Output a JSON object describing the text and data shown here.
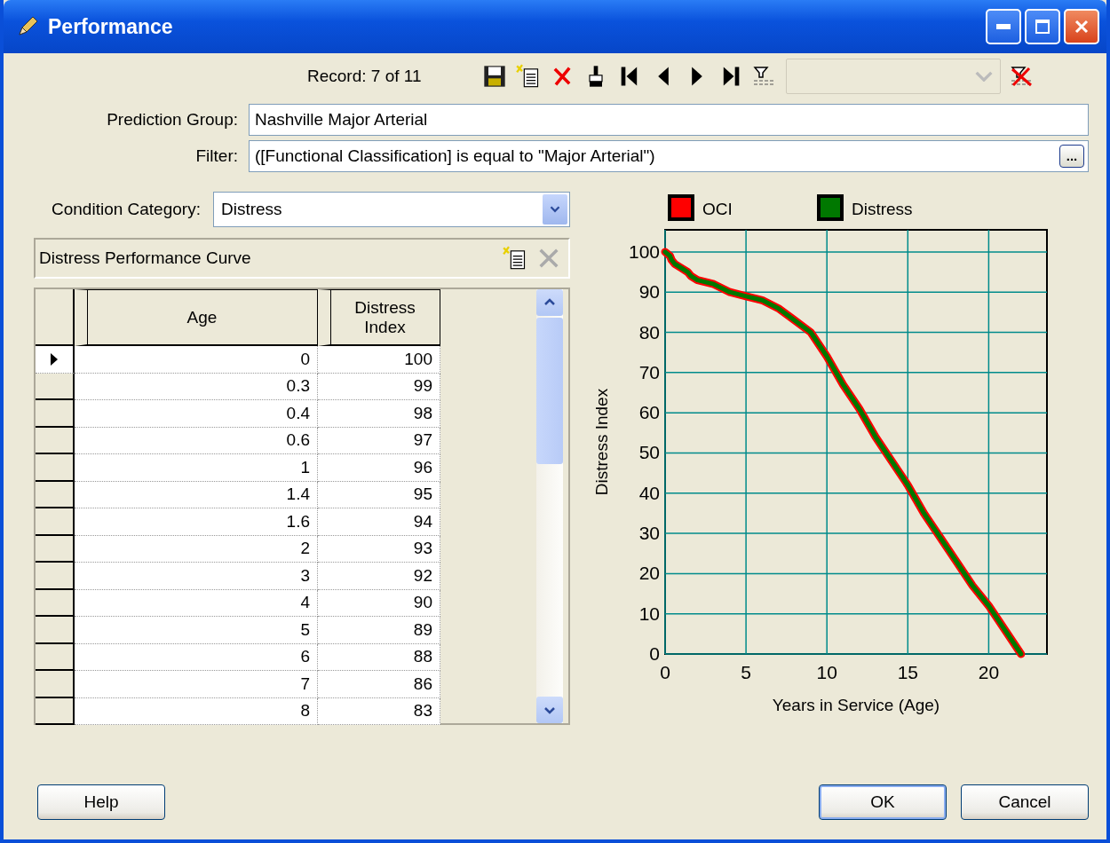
{
  "window": {
    "title": "Performance"
  },
  "toolbar": {
    "record": "Record: 7 of 11",
    "filter_combo": {
      "disabled": true
    }
  },
  "fields": [
    {
      "label": "Prediction Group:",
      "value": "Nashville Major Arterial",
      "kind": "text"
    },
    {
      "label": "Filter:",
      "value": "([Functional Classification] is equal to \"Major Arterial\")",
      "kind": "browse",
      "button": "..."
    }
  ],
  "condition_category": {
    "label": "Condition Category:",
    "value": "Distress"
  },
  "curve_panel": {
    "title": "Distress Performance Curve",
    "columns": [
      "Age",
      "Distress Index"
    ],
    "rows": [
      {
        "age": "0",
        "index": "100",
        "selected": true
      },
      {
        "age": "0.3",
        "index": "99",
        "selected": false
      },
      {
        "age": "0.4",
        "index": "98",
        "selected": false
      },
      {
        "age": "0.6",
        "index": "97",
        "selected": false
      },
      {
        "age": "1",
        "index": "96",
        "selected": false
      },
      {
        "age": "1.4",
        "index": "95",
        "selected": false
      },
      {
        "age": "1.6",
        "index": "94",
        "selected": false
      },
      {
        "age": "2",
        "index": "93",
        "selected": false
      },
      {
        "age": "3",
        "index": "92",
        "selected": false
      },
      {
        "age": "4",
        "index": "90",
        "selected": false
      },
      {
        "age": "5",
        "index": "89",
        "selected": false
      },
      {
        "age": "6",
        "index": "88",
        "selected": false
      },
      {
        "age": "7",
        "index": "86",
        "selected": false
      },
      {
        "age": "8",
        "index": "83",
        "selected": false
      }
    ]
  },
  "chart": {
    "chart_data": {
      "type": "line",
      "xlabel": "Years in Service (Age)",
      "ylabel": "Distress Index",
      "x": [
        0,
        0.3,
        0.4,
        0.6,
        1,
        1.4,
        1.6,
        2,
        3,
        4,
        5,
        6,
        7,
        8,
        9,
        10,
        11,
        12,
        13,
        14,
        15,
        16,
        17,
        18,
        19,
        20,
        21,
        22
      ],
      "series": [
        {
          "name": "OCI",
          "color": "#ff0000",
          "values": [
            100,
            99,
            98,
            97,
            96,
            95,
            94,
            93,
            92,
            90,
            89,
            88,
            86,
            83,
            80,
            74,
            67,
            61,
            54,
            48,
            42,
            35,
            29,
            23,
            17,
            12,
            6,
            0
          ]
        },
        {
          "name": "Distress",
          "color": "#007800",
          "values": [
            100,
            99,
            98,
            97,
            96,
            95,
            94,
            93,
            92,
            90,
            89,
            88,
            86,
            83,
            80,
            74,
            67,
            61,
            54,
            48,
            42,
            35,
            29,
            23,
            17,
            12,
            6,
            0
          ]
        }
      ],
      "grid": true,
      "legend": true,
      "xlim": [
        0,
        23.6
      ],
      "ylim": [
        0,
        105.5
      ],
      "xticks": [
        0,
        5,
        10,
        15,
        20
      ],
      "yticks": [
        0,
        10,
        20,
        30,
        40,
        50,
        60,
        70,
        80,
        90,
        100
      ]
    }
  },
  "footer": {
    "left_buttons": [
      {
        "label": "Help",
        "default": false
      }
    ],
    "right_buttons": [
      {
        "label": "OK",
        "default": true
      },
      {
        "label": "Cancel",
        "default": false
      }
    ]
  }
}
